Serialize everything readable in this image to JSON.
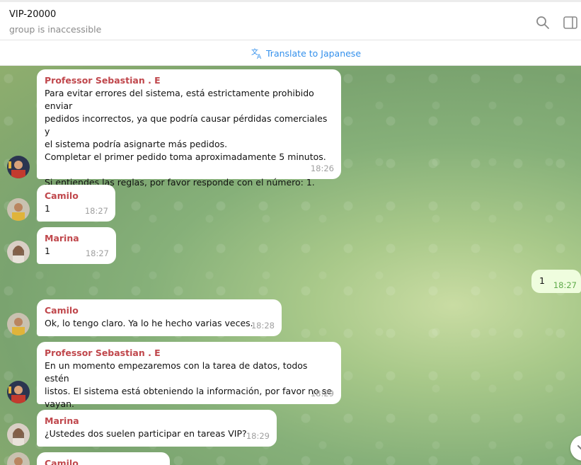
{
  "header": {
    "title": "VIP-20000",
    "subtitle": "group is inaccessible"
  },
  "translate": {
    "label": "Translate to Japanese"
  },
  "messages": [
    {
      "sender": "Professor Sebastian . E",
      "text": "Para evitar errores del sistema, está estrictamente prohibido enviar\npedidos incorrectos, ya que podría causar pérdidas comerciales y\nel sistema podría asignarte más pedidos.\nCompletar el primer pedido toma aproximadamente 5 minutos.\n\nSi entiendes las reglas, por favor responde con el número: 1.",
      "time": "18:26"
    },
    {
      "sender": "Camilo",
      "text": "1",
      "time": "18:27"
    },
    {
      "sender": "Marina",
      "text": "1",
      "time": "18:27"
    },
    {
      "sender": "Camilo",
      "text": "Ok, lo tengo claro. Ya lo he hecho varias veces.",
      "time": "18:28"
    },
    {
      "sender": "Professor Sebastian . E",
      "text": "En un momento empezaremos con la tarea de datos, todos estén\nlistos. El sistema está obteniendo la información, por favor no se\nvayan.",
      "time": "18:29"
    },
    {
      "sender": "Marina",
      "text": "¿Ustedes dos suelen participar en tareas VIP?",
      "time": "18:29"
    },
    {
      "sender": "Camilo"
    }
  ],
  "outgoing": {
    "text": "1",
    "time": "18:27"
  },
  "colors": {
    "accent": "#3390ec",
    "sender": "#c0474c",
    "outgoing_bubble": "#effdde"
  }
}
